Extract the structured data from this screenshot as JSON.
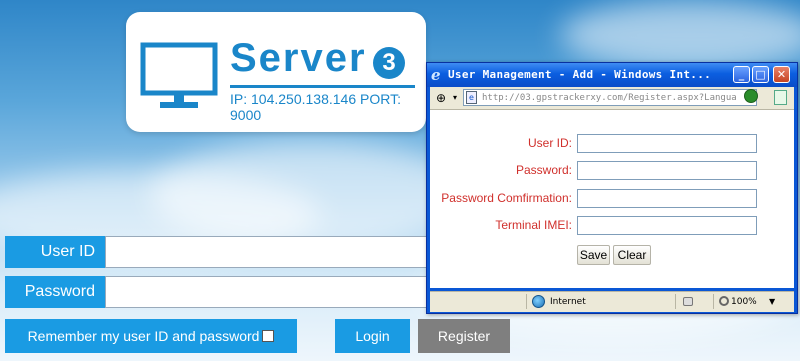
{
  "logo": {
    "title": "Server",
    "number": "3",
    "ip_line": "IP: 104.250.138.146  PORT: 9000"
  },
  "login": {
    "user_id_label": "User ID",
    "password_label": "Password",
    "user_id_value": "",
    "password_value": "",
    "remember_label": "Remember my user ID and password",
    "remember_checked": false,
    "login_button": "Login",
    "register_button": "Register"
  },
  "popup": {
    "title": "User Management - Add - Windows Int...",
    "address": "http://03.gpstrackerxy.com/Register.aspx?Langua",
    "fields": [
      {
        "label": "User ID:",
        "value": ""
      },
      {
        "label": "Password:",
        "value": ""
      },
      {
        "label": "Password Comfirmation:",
        "value": ""
      },
      {
        "label": "Terminal IMEI:",
        "value": ""
      }
    ],
    "save_button": "Save",
    "clear_button": "Clear",
    "status_zone": "Internet",
    "zoom": "100%"
  },
  "colors": {
    "accent": "#1a9be3",
    "logo_blue": "#1a86c9",
    "register_gray": "#7f7f7f",
    "label_red": "#d0302c",
    "xp_title_blue": "#0a57d5"
  }
}
